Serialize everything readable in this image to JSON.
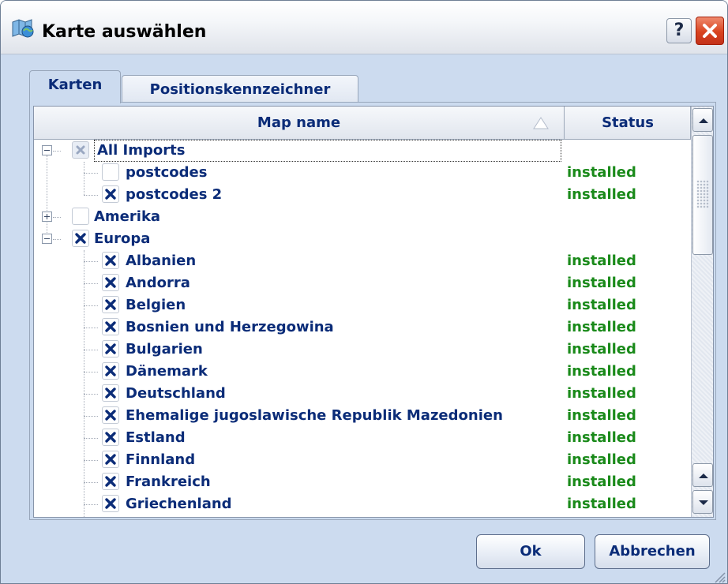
{
  "window": {
    "title": "Karte auswählen",
    "app_icon": "map-globe-icon",
    "help_label": "?",
    "close_icon": "close-icon"
  },
  "tabs": [
    {
      "label": "Karten",
      "active": true
    },
    {
      "label": "Positionskennzeichner",
      "active": false
    }
  ],
  "list": {
    "columns": {
      "map_name": "Map name",
      "status": "Status"
    },
    "sort_icon": "sort-ascending-icon",
    "rows": [
      {
        "label": "All Imports",
        "level": 0,
        "expander": "minus",
        "check": "partial",
        "status": "",
        "focused": true
      },
      {
        "label": "postcodes",
        "level": 1,
        "check": "unchecked",
        "status": "installed"
      },
      {
        "label": "postcodes 2",
        "level": 1,
        "check": "checked",
        "status": "installed"
      },
      {
        "label": "Amerika",
        "level": 0,
        "expander": "plus",
        "check": "unchecked",
        "status": ""
      },
      {
        "label": "Europa",
        "level": 0,
        "expander": "minus",
        "check": "checked",
        "status": ""
      },
      {
        "label": "Albanien",
        "level": 1,
        "check": "checked",
        "status": "installed"
      },
      {
        "label": "Andorra",
        "level": 1,
        "check": "checked",
        "status": "installed"
      },
      {
        "label": "Belgien",
        "level": 1,
        "check": "checked",
        "status": "installed"
      },
      {
        "label": "Bosnien und Herzegowina",
        "level": 1,
        "check": "checked",
        "status": "installed"
      },
      {
        "label": "Bulgarien",
        "level": 1,
        "check": "checked",
        "status": "installed"
      },
      {
        "label": "Dänemark",
        "level": 1,
        "check": "checked",
        "status": "installed"
      },
      {
        "label": "Deutschland",
        "level": 1,
        "check": "checked",
        "status": "installed"
      },
      {
        "label": "Ehemalige jugoslawische Republik Mazedonien",
        "level": 1,
        "check": "checked",
        "status": "installed"
      },
      {
        "label": "Estland",
        "level": 1,
        "check": "checked",
        "status": "installed"
      },
      {
        "label": "Finnland",
        "level": 1,
        "check": "checked",
        "status": "installed"
      },
      {
        "label": "Frankreich",
        "level": 1,
        "check": "checked",
        "status": "installed"
      },
      {
        "label": "Griechenland",
        "level": 1,
        "check": "checked",
        "status": "installed"
      }
    ]
  },
  "buttons": {
    "ok": "Ok",
    "cancel": "Abbrechen"
  },
  "colors": {
    "label_text": "#0b2c78",
    "status_installed": "#1a8a1a",
    "dialog_background": "#ccdbef",
    "close_button": "#d9431f"
  }
}
